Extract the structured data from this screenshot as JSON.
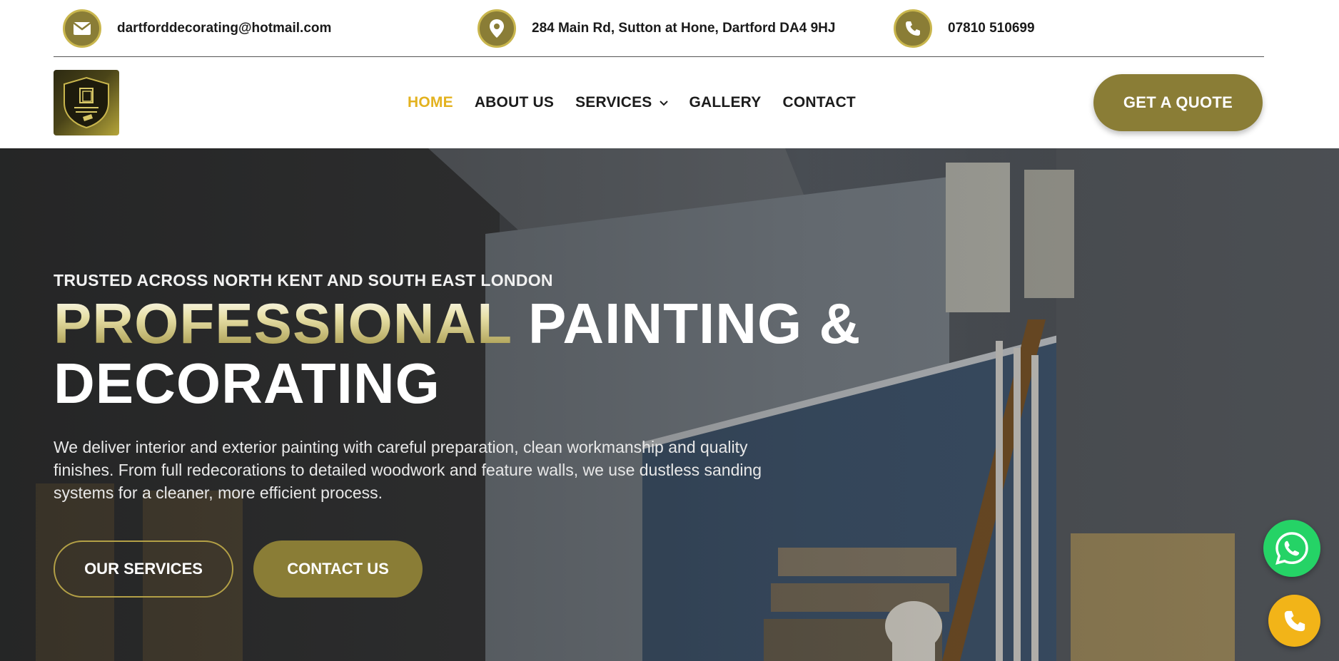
{
  "contact_bar": {
    "email": "dartforddecorating@hotmail.com",
    "address": "284 Main Rd, Sutton at Hone, Dartford DA4 9HJ",
    "phone": "07810 510699",
    "icons": [
      "envelope-icon",
      "map-pin-icon",
      "phone-icon"
    ]
  },
  "nav": {
    "items": [
      {
        "label": "HOME",
        "active": true
      },
      {
        "label": "ABOUT US",
        "active": false
      },
      {
        "label": "SERVICES",
        "active": false,
        "has_dropdown": true
      },
      {
        "label": "GALLERY",
        "active": false
      },
      {
        "label": "CONTACT",
        "active": false
      }
    ],
    "cta": "GET A QUOTE"
  },
  "hero": {
    "eyebrow": "TRUSTED ACROSS NORTH KENT AND SOUTH EAST LONDON",
    "headline_highlight": "PROFESSIONAL",
    "headline_rest_1": " PAINTING &",
    "headline_rest_2": "DECORATING",
    "description": "We deliver interior and exterior painting with careful preparation, clean workmanship and quality finishes. From full redecorations to detailed woodwork and feature walls, we use dustless sanding systems for a cleaner, more efficient process.",
    "buttons": {
      "services": "OUR SERVICES",
      "contact": "CONTACT US"
    }
  },
  "floating": {
    "icons": [
      "whatsapp-icon",
      "phone-icon"
    ]
  },
  "colors": {
    "brand_olive": "#8a7d36",
    "active_nav": "#e3b21f",
    "whatsapp_green": "#25d366",
    "call_yellow": "#f2b418"
  }
}
